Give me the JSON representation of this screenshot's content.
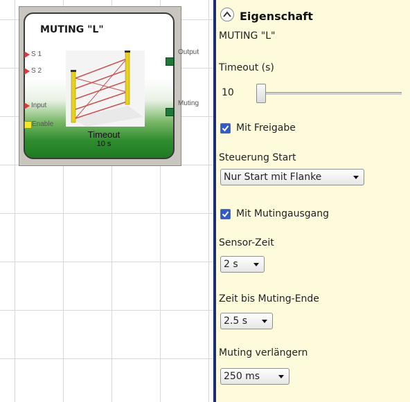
{
  "block": {
    "title": "MUTING \"L\"",
    "inputs": [
      "S 1",
      "S 2",
      "Input",
      "Enable"
    ],
    "outputs": [
      "Output",
      "Muting"
    ],
    "timeout_label": "Timeout",
    "timeout_value": "10 s"
  },
  "panel": {
    "header": "Eigenschaft",
    "component_name": "MUTING \"L\"",
    "timeout": {
      "label": "Timeout (s)",
      "value": "10"
    },
    "enable_checkbox": {
      "label": "Mit Freigabe",
      "checked": true
    },
    "start_control": {
      "label": "Steuerung Start",
      "selected": "Nur Start mit Flanke"
    },
    "muting_output_checkbox": {
      "label": "Mit Mutingausgang",
      "checked": true
    },
    "sensor_time": {
      "label": "Sensor-Zeit",
      "selected": "2 s"
    },
    "time_to_muting_end": {
      "label": "Zeit bis Muting-Ende",
      "selected": "2.5 s"
    },
    "muting_extend": {
      "label": "Muting verlängern",
      "selected": "250 ms"
    }
  },
  "colors": {
    "panel_bg": "#fdfbdc",
    "divider": "#1e2f6f",
    "block_green": "#2f8c2e",
    "pin_red": "#e2343a",
    "checkbox_blue": "#2f5cc8"
  }
}
